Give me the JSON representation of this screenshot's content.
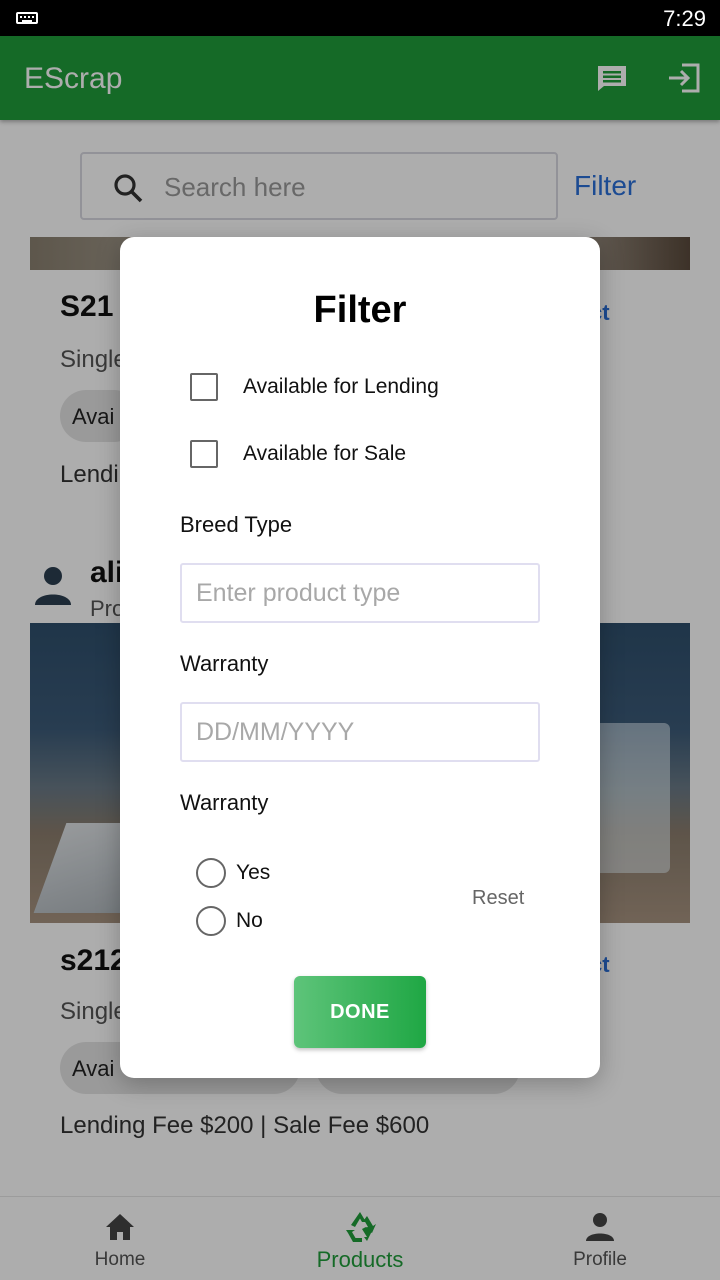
{
  "status_bar": {
    "time": "7:29",
    "keyboard_icon": "keyboard-icon"
  },
  "app_bar": {
    "title": "EScrap",
    "chat_icon": "chat-icon",
    "login_icon": "login-icon"
  },
  "search": {
    "placeholder": "Search here",
    "filter_label": "Filter"
  },
  "products": [
    {
      "name": "S21",
      "subtitle": "Single",
      "chip": "Avai",
      "fees": "Lendi",
      "contact": "ct"
    },
    {
      "user": "ali",
      "role": "Pro",
      "name": "s212",
      "subtitle": "Single",
      "chip": "Avai",
      "fees": "Lending Fee $200 | Sale Fee $600",
      "contact": "ct"
    }
  ],
  "filter_dialog": {
    "title": "Filter",
    "options": [
      {
        "label": "Available for Lending",
        "checked": false
      },
      {
        "label": "Available for Sale",
        "checked": false
      }
    ],
    "breed_type_label": "Breed Type",
    "breed_type_placeholder": "Enter product type",
    "warranty_date_label": "Warranty",
    "warranty_date_placeholder": "DD/MM/YYYY",
    "warranty_label": "Warranty",
    "warranty_options": [
      {
        "label": "Yes",
        "selected": false
      },
      {
        "label": "No",
        "selected": false
      }
    ],
    "reset_label": "Reset",
    "done_label": "DONE"
  },
  "bottom_nav": {
    "items": [
      {
        "label": "Home",
        "icon": "home-icon",
        "active": false
      },
      {
        "label": "Products",
        "icon": "recycle-icon",
        "active": true
      },
      {
        "label": "Profile",
        "icon": "person-icon",
        "active": false
      }
    ]
  },
  "colors": {
    "primary": "#1f9d3a",
    "link": "#2a6fd8",
    "done_start": "#5ec47a",
    "done_end": "#1fa744"
  }
}
